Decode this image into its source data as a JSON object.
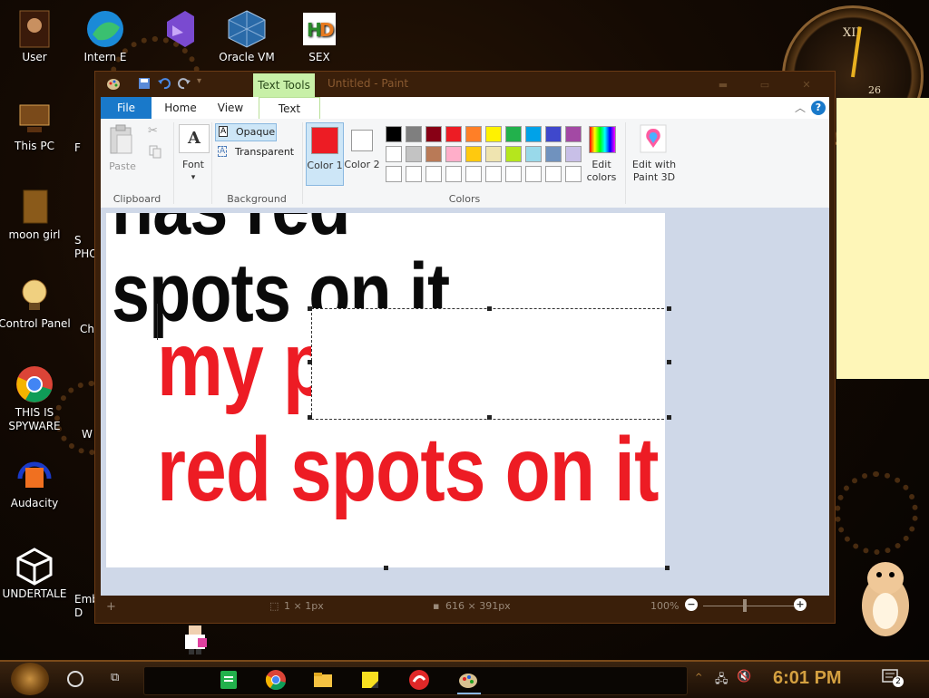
{
  "desktop": {
    "icons": [
      {
        "label": "User"
      },
      {
        "label": "Intern E"
      },
      {
        "label": ""
      },
      {
        "label": "Oracle VM"
      },
      {
        "label": "SEX"
      },
      {
        "label": "This PC"
      },
      {
        "label": "moon girl"
      },
      {
        "label": "Control Panel"
      },
      {
        "label": "THIS IS SPYWARE"
      },
      {
        "label": "Audacity"
      },
      {
        "label": "UNDERTALE"
      }
    ],
    "partial_labels": [
      "F",
      "S PHO",
      "Ch",
      "W",
      "Emb D"
    ],
    "clock": {
      "numeral": "XII",
      "date": "26"
    }
  },
  "paint": {
    "title": "Untitled - Paint",
    "contextual_tab": "Text Tools",
    "tabs": {
      "file": "File",
      "home": "Home",
      "view": "View",
      "text": "Text"
    },
    "help": "?",
    "clipboard": {
      "paste": "Paste",
      "group": "Clipboard"
    },
    "font": {
      "label": "Font",
      "glyph": "A",
      "group": ""
    },
    "background": {
      "opaque": "Opaque",
      "transparent": "Transparent",
      "group": "Background"
    },
    "colors": {
      "color1_label": "Color 1",
      "color1_value": "#ed1c24",
      "color2_label": "Color 2",
      "color2_value": "#ffffff",
      "group": "Colors",
      "edit_label": "Edit colors",
      "paint3d_label": "Edit with Paint 3D",
      "palette_row1": [
        "#000000",
        "#7f7f7f",
        "#880015",
        "#ed1c24",
        "#ff7f27",
        "#fff200",
        "#22b14c",
        "#00a2e8",
        "#3f48cc",
        "#a349a4"
      ],
      "palette_row2": [
        "#ffffff",
        "#c3c3c3",
        "#b97a57",
        "#ffaec9",
        "#ffc90e",
        "#efe4b0",
        "#b5e61d",
        "#99d9ea",
        "#7092be",
        "#c8bfe7"
      ],
      "palette_row3": [
        "#ffffff",
        "#ffffff",
        "#ffffff",
        "#ffffff",
        "#ffffff",
        "#ffffff",
        "#ffffff",
        "#ffffff",
        "#ffffff",
        "#ffffff"
      ]
    },
    "canvas": {
      "black_line1": "has red",
      "black_line2": "spots on it",
      "red_line1": "my p",
      "red_line2": "red spots on it"
    },
    "status": {
      "cursor": "1 × 1px",
      "size": "616 × 391px",
      "zoom": "100%"
    }
  },
  "taskbar": {
    "time": "6:01 PM",
    "notification_count": "2"
  }
}
